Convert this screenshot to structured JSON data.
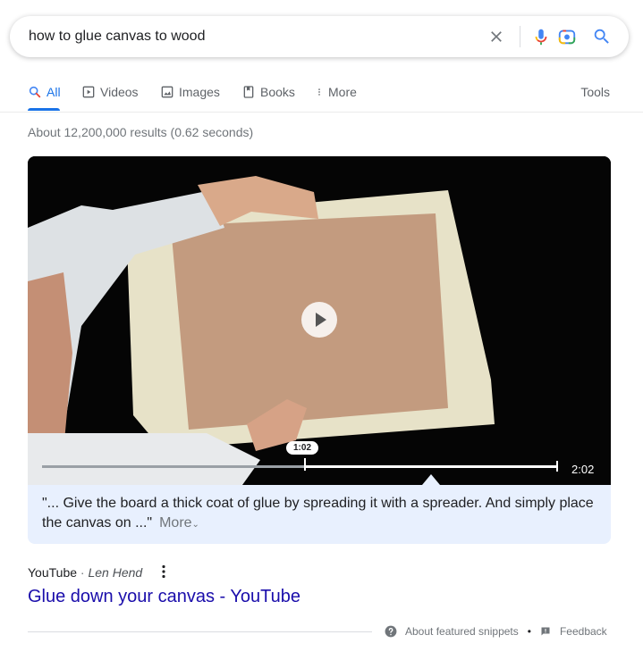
{
  "search": {
    "query": "how to glue canvas to wood"
  },
  "tabs": [
    {
      "label": "All",
      "icon": "search-icon",
      "active": true
    },
    {
      "label": "Videos",
      "icon": "video-icon"
    },
    {
      "label": "Images",
      "icon": "image-icon"
    },
    {
      "label": "Books",
      "icon": "book-icon"
    },
    {
      "label": "More",
      "icon": "dots-vertical-icon"
    }
  ],
  "tools_label": "Tools",
  "result_stats": "About 12,200,000 results (0.62 seconds)",
  "snippet": {
    "video": {
      "current_time": "1:02",
      "duration": "2:02",
      "progress_fraction": 0.508
    },
    "quote": "\"... Give the board a thick coat of glue by spreading it with a spreader. And simply place the canvas on ...\"",
    "more_label": "More"
  },
  "result": {
    "source": "YouTube",
    "separator": "·",
    "author": "Len Hend",
    "title": "Glue down your canvas - YouTube"
  },
  "footer": {
    "about_label": "About featured snippets",
    "bullet": "•",
    "feedback_label": "Feedback"
  },
  "colors": {
    "accent": "#1a73e8",
    "link": "#1a0dab",
    "snippet_bg": "#e8f0fe"
  }
}
